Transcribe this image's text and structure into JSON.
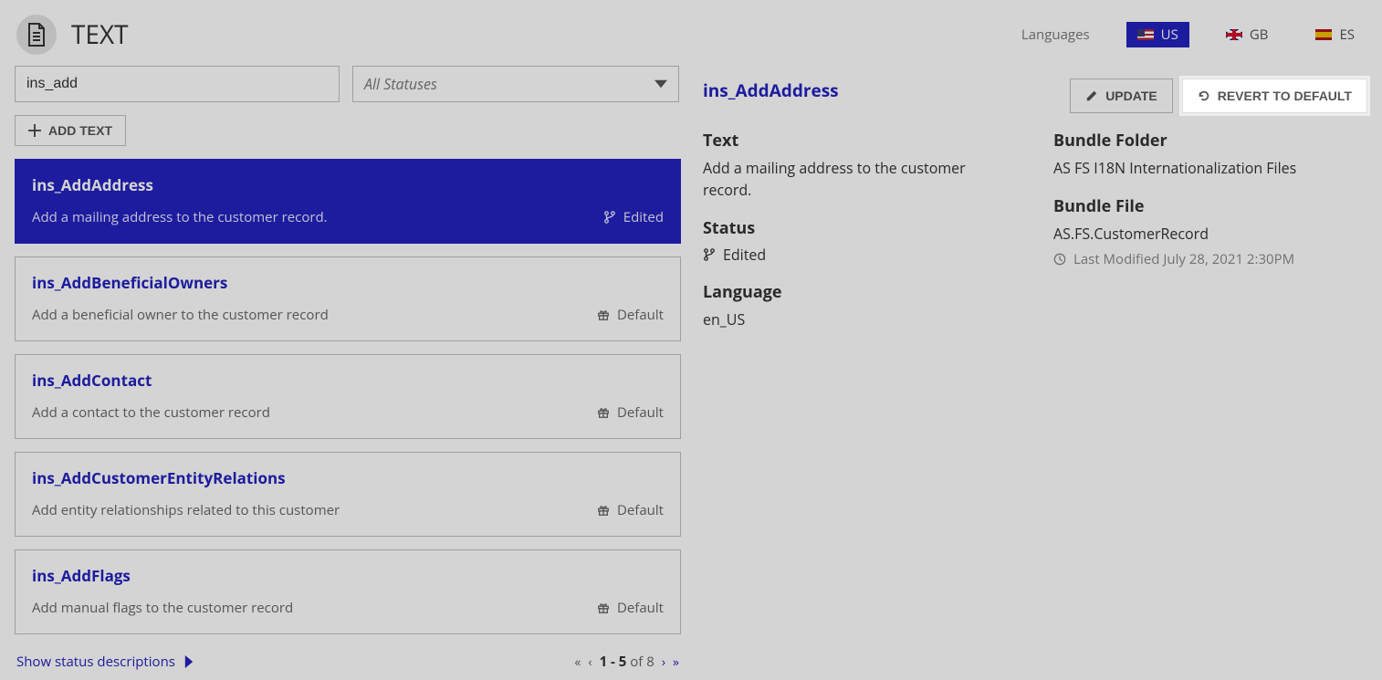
{
  "header": {
    "title": "TEXT",
    "languages_label": "Languages",
    "langs": [
      {
        "code": "US",
        "active": true
      },
      {
        "code": "GB",
        "active": false
      },
      {
        "code": "ES",
        "active": false
      }
    ]
  },
  "filters": {
    "search_value": "ins_add",
    "status_placeholder": "All Statuses"
  },
  "toolbar": {
    "add_text_label": "ADD TEXT"
  },
  "list": [
    {
      "key": "ins_AddAddress",
      "text": "Add a mailing address to the customer record.",
      "status": "Edited",
      "selected": true
    },
    {
      "key": "ins_AddBeneficialOwners",
      "text": "Add a beneficial owner to the customer record",
      "status": "Default",
      "selected": false
    },
    {
      "key": "ins_AddContact",
      "text": "Add a contact to the customer record",
      "status": "Default",
      "selected": false
    },
    {
      "key": "ins_AddCustomerEntityRelations",
      "text": "Add entity relationships related to this customer",
      "status": "Default",
      "selected": false
    },
    {
      "key": "ins_AddFlags",
      "text": "Add manual flags to the customer record",
      "status": "Default",
      "selected": false
    }
  ],
  "list_footer": {
    "show_desc_label": "Show status descriptions",
    "page_range": "1 - 5",
    "page_of": "of",
    "page_total": "8"
  },
  "detail": {
    "title": "ins_AddAddress",
    "update_label": "UPDATE",
    "revert_label": "REVERT TO DEFAULT",
    "text_h": "Text",
    "text_v": "Add a mailing address to the customer record.",
    "status_h": "Status",
    "status_v": "Edited",
    "language_h": "Language",
    "language_v": "en_US",
    "bundle_folder_h": "Bundle Folder",
    "bundle_folder_v": "AS FS I18N Internationalization Files",
    "bundle_file_h": "Bundle File",
    "bundle_file_v": "AS.FS.CustomerRecord",
    "last_modified": "Last Modified July 28, 2021 2:30PM"
  }
}
